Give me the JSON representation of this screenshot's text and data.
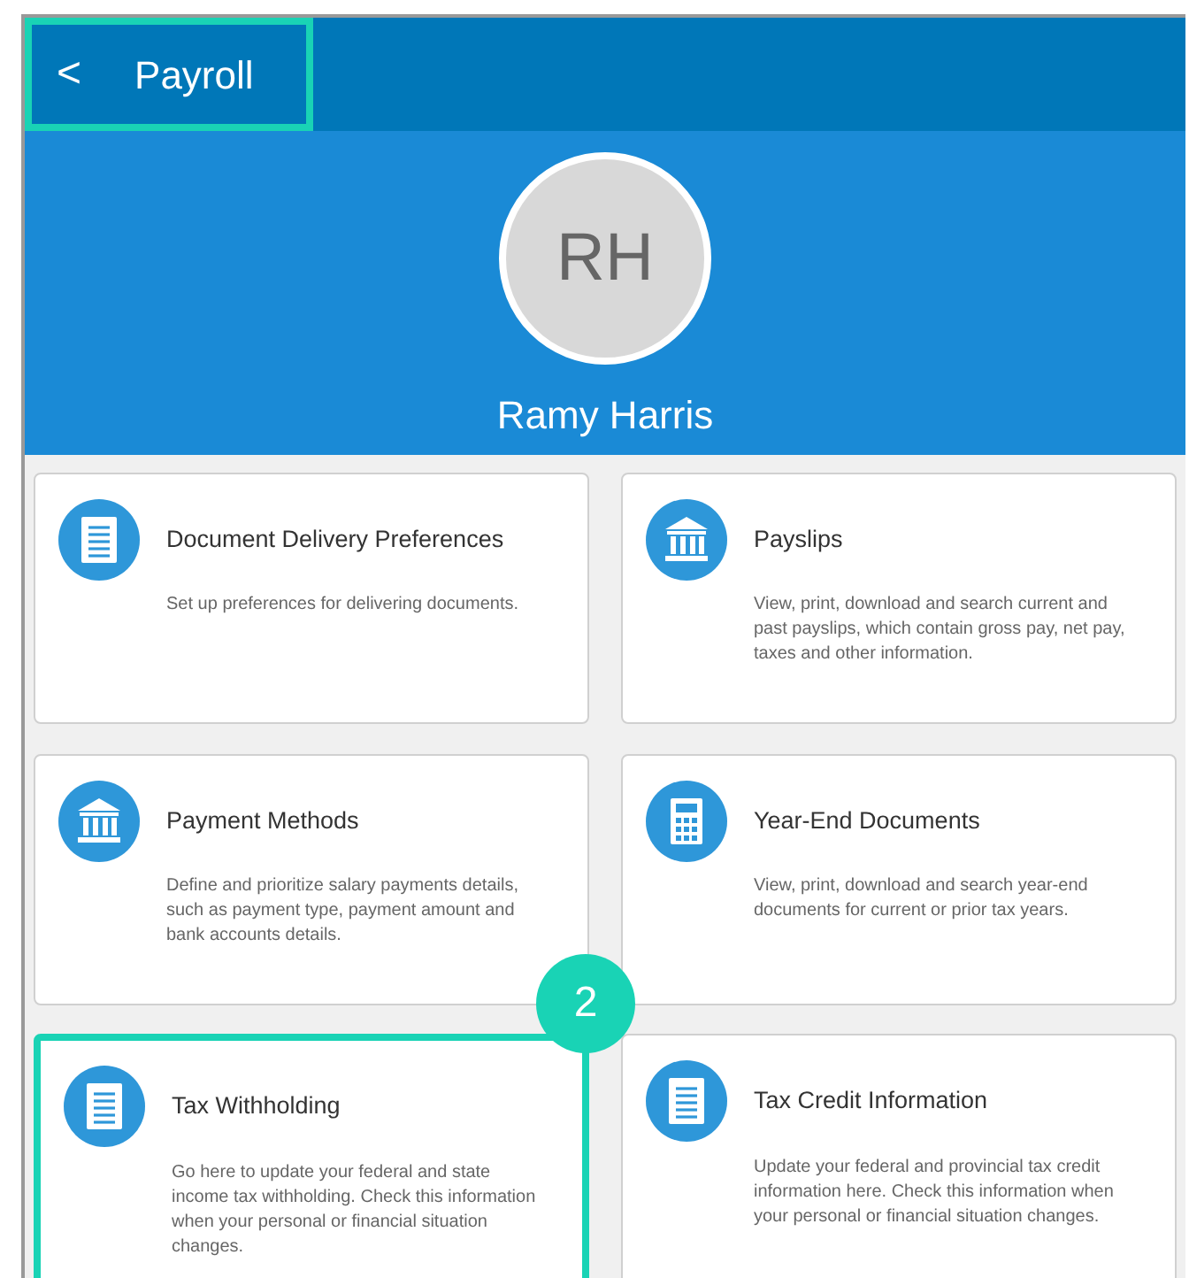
{
  "header": {
    "back_icon": "<",
    "title": "Payroll",
    "highlighted": true
  },
  "profile": {
    "initials": "RH",
    "name": "Ramy Harris"
  },
  "tiles": [
    {
      "kind": "document",
      "title": "Document Delivery Preferences",
      "description": "Set up preferences for delivering documents.",
      "highlighted": false
    },
    {
      "kind": "bank",
      "title": "Payslips",
      "description": "View, print, download and search current and past payslips, which contain gross pay, net pay, taxes and other information.",
      "highlighted": false
    },
    {
      "kind": "bank",
      "title": "Payment Methods",
      "description": "Define and prioritize salary payments details, such as payment type, payment amount and bank accounts details.",
      "highlighted": false
    },
    {
      "kind": "calculator",
      "title": "Year-End Documents",
      "description": "View, print, download and search year-end documents for current or prior tax years.",
      "highlighted": false
    },
    {
      "kind": "document",
      "title": "Tax Withholding",
      "description": "Go here to update your federal and state income tax withholding. Check this information when your personal or financial situation changes.",
      "highlighted": true
    },
    {
      "kind": "document",
      "title": "Tax Credit Information",
      "description": "Update your federal and provincial tax credit information here. Check this information when your personal or financial situation changes.",
      "highlighted": false
    }
  ],
  "callout": {
    "label": "2"
  }
}
